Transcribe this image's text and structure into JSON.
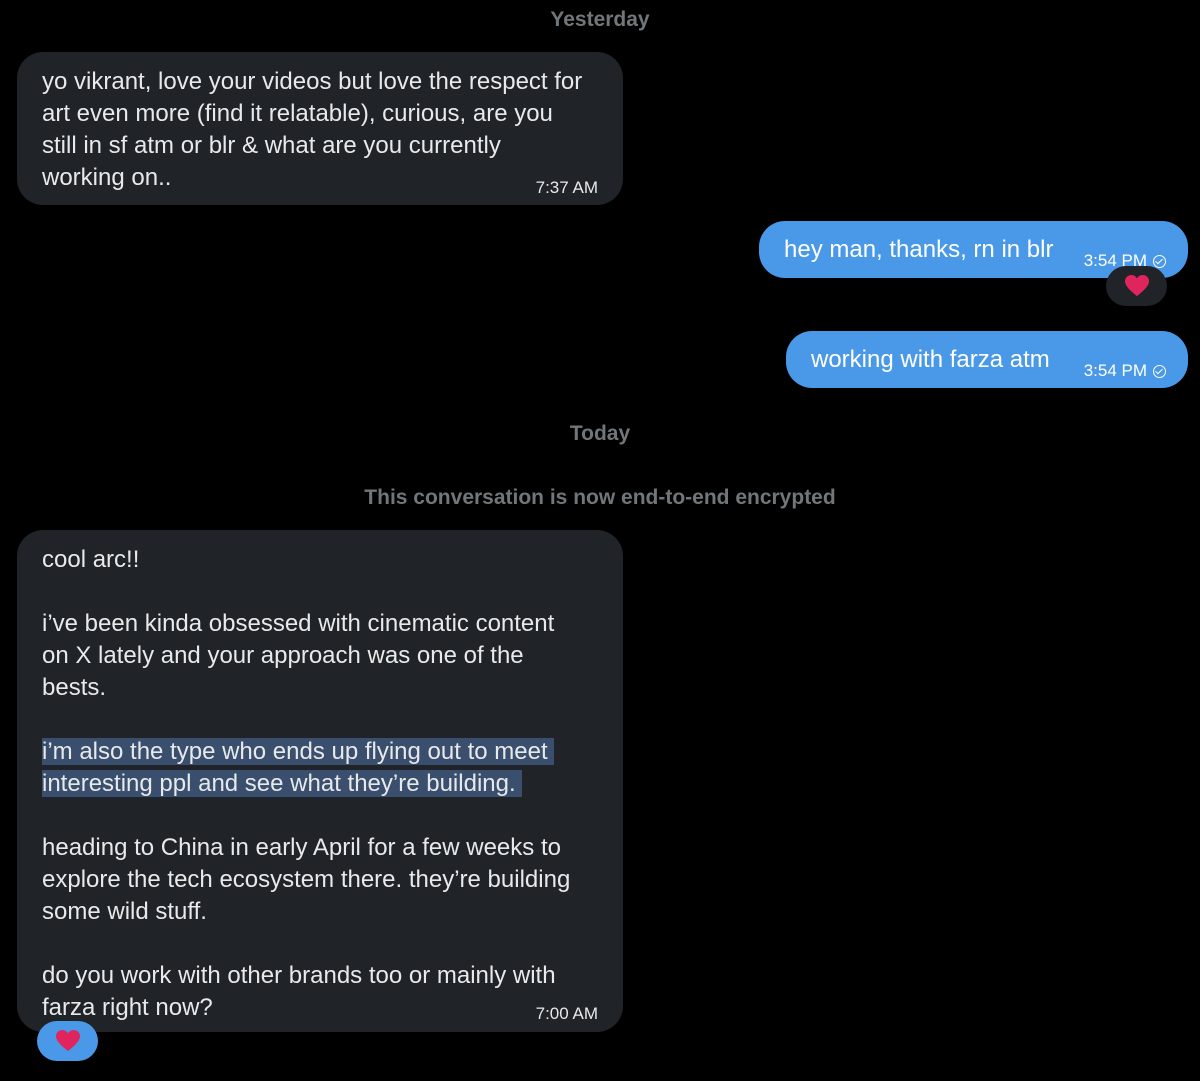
{
  "dividers": {
    "yesterday": "Yesterday",
    "today": "Today",
    "encryption_notice": "This conversation is now end-to-end encrypted"
  },
  "messages": {
    "m1": {
      "text": "yo vikrant, love your videos but love the respect for\nart even more (find it relatable), curious, are you\nstill in sf atm or blr & what are you currently\nworking on..",
      "time": "7:37 AM"
    },
    "m2": {
      "text": "hey man, thanks, rn in blr",
      "time": "3:54 PM"
    },
    "m3": {
      "text": "working with farza atm",
      "time": "3:54 PM"
    },
    "m4": {
      "p1": "cool arc!!",
      "p2": "i’ve been kinda obsessed with cinematic content\non X lately and your approach was one of the\nbests.",
      "p3_l1": "i’m also the type who ends up flying out to meet ",
      "p3_l2": "interesting ppl and see what they’re building. ",
      "p4": "heading to China in early April for a few weeks to\nexplore the tech ecosystem there. they’re building\nsome wild stuff.",
      "p5": "do you work with other brands too or mainly with\nfarza right now?",
      "time": "7:00 AM"
    }
  },
  "reactions": {
    "r1": {
      "emoji": "heart",
      "color": "#e0245e"
    },
    "r2": {
      "emoji": "heart",
      "color": "#e0245e"
    }
  },
  "colors": {
    "background": "#000000",
    "received_bubble": "#202327",
    "sent_bubble": "#4a99e9",
    "highlight": "#3a4f6e",
    "muted_text": "#71767b"
  }
}
